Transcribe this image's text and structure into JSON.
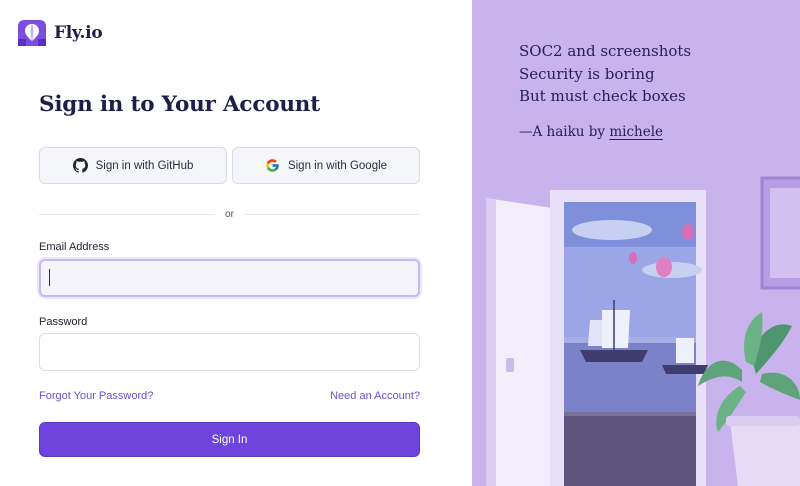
{
  "brand": {
    "name": "Fly.io",
    "logo_icon": "balloon-logo-icon",
    "accent_color": "#6d44dc"
  },
  "page": {
    "title": "Sign in to Your Account"
  },
  "oauth": {
    "github_label": "Sign in with GitHub",
    "github_icon": "github-icon",
    "google_label": "Sign in with Google",
    "google_icon": "google-icon"
  },
  "divider": {
    "text": "or"
  },
  "form": {
    "email_label": "Email Address",
    "email_value": "",
    "email_placeholder": "",
    "password_label": "Password",
    "password_value": "",
    "password_placeholder": ""
  },
  "links": {
    "forgot": "Forgot Your Password?",
    "need_account": "Need an Account?"
  },
  "submit": {
    "label": "Sign In"
  },
  "haiku": {
    "line1": "SOC2 and screenshots",
    "line2": "Security is boring",
    "line3": "But must check boxes",
    "attribution_prefix": "—A haiku by ",
    "author": "michele"
  }
}
